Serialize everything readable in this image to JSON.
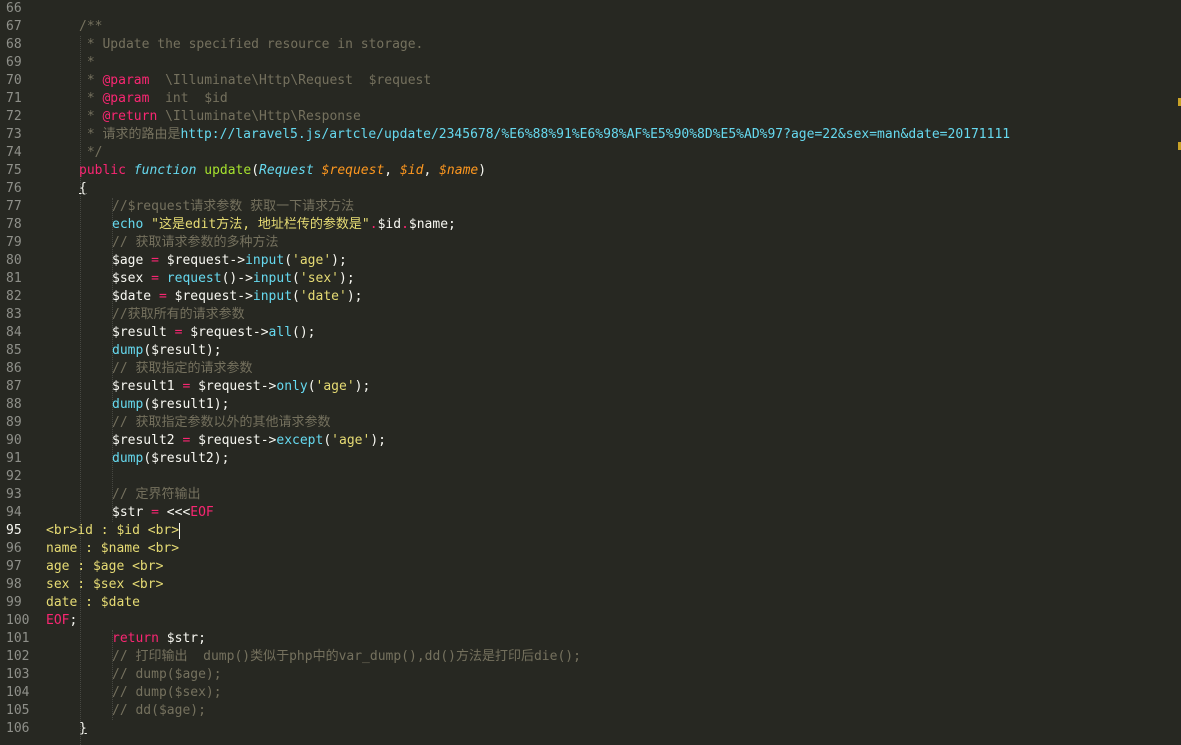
{
  "editor": {
    "language": "php",
    "active_line": "95",
    "theme_colors": {
      "background": "#272822",
      "comment": "#75715E",
      "keyword": "#F92672",
      "function": "#A6E22E",
      "string": "#E6DB74",
      "type": "#66D9EF",
      "parameter": "#FD971F"
    }
  },
  "line_numbers": [
    "66",
    "67",
    "68",
    "69",
    "70",
    "71",
    "72",
    "73",
    "74",
    "75",
    "76",
    "77",
    "78",
    "79",
    "80",
    "81",
    "82",
    "83",
    "84",
    "85",
    "86",
    "87",
    "88",
    "89",
    "90",
    "91",
    "92",
    "93",
    "94",
    "95",
    "96",
    "97",
    "98",
    "99",
    "100",
    "101",
    "102",
    "103",
    "104",
    "105",
    "106"
  ],
  "code": {
    "l67": "/**",
    "l68": " * Update the specified resource in storage.",
    "l69": " *",
    "l70_a": " * ",
    "l70_b": "@param",
    "l70_c": "  \\Illuminate\\Http\\Request  $request",
    "l71_a": " * ",
    "l71_b": "@param",
    "l71_c": "  int  $id",
    "l72_a": " * ",
    "l72_b": "@return",
    "l72_c": " \\Illuminate\\Http\\Response",
    "l73_a": " * 请求的路由是",
    "l73_b": "http://laravel5.js/artcle/update/2345678/%E6%88%91%E6%98%AF%E5%90%8D%E5%AD%97?age=22&sex=man&date=20171111",
    "l74": " */",
    "l75_a": "public",
    "l75_b": "function",
    "l75_c": "update",
    "l75_d": "(",
    "l75_e": "Request",
    "l75_f": "$request",
    "l75_g": ", ",
    "l75_h": "$id",
    "l75_i": ", ",
    "l75_j": "$name",
    "l75_k": ")",
    "l76": "{",
    "l77": "//$request请求参数 获取一下请求方法",
    "l78_a": "echo",
    "l78_b": "\"这是edit方法, 地址栏传的参数是\"",
    "l78_c": ".",
    "l78_d": "$id",
    "l78_e": ".",
    "l78_f": "$name;",
    "l79": "// 获取请求参数的多种方法",
    "l80_a": "$age ",
    "l80_b": "=",
    "l80_c": " $request->",
    "l80_d": "input",
    "l80_e": "(",
    "l80_f": "'age'",
    "l80_g": ");",
    "l81_a": "$sex ",
    "l81_b": "=",
    "l81_c": " ",
    "l81_d": "request",
    "l81_e": "()->",
    "l81_f": "input",
    "l81_g": "(",
    "l81_h": "'sex'",
    "l81_i": ");",
    "l82_a": "$date ",
    "l82_b": "=",
    "l82_c": " $request->",
    "l82_d": "input",
    "l82_e": "(",
    "l82_f": "'date'",
    "l82_g": ");",
    "l83": "//获取所有的请求参数",
    "l84_a": "$result ",
    "l84_b": "=",
    "l84_c": " $request->",
    "l84_d": "all",
    "l84_e": "();",
    "l85_a": "dump",
    "l85_b": "($result);",
    "l86": "// 获取指定的请求参数",
    "l87_a": "$result1 ",
    "l87_b": "=",
    "l87_c": " $request->",
    "l87_d": "only",
    "l87_e": "(",
    "l87_f": "'age'",
    "l87_g": ");",
    "l88_a": "dump",
    "l88_b": "($result1);",
    "l89": "// 获取指定参数以外的其他请求参数",
    "l90_a": "$result2 ",
    "l90_b": "=",
    "l90_c": " $request->",
    "l90_d": "except",
    "l90_e": "(",
    "l90_f": "'age'",
    "l90_g": ");",
    "l91_a": "dump",
    "l91_b": "($result2);",
    "l93": "// 定界符输出",
    "l94_a": "$str ",
    "l94_b": "=",
    "l94_c": " <<<",
    "l94_d": "EOF",
    "l95": "<br>id : $id <br>",
    "l96": "name : $name <br>",
    "l97": "age : $age <br>",
    "l98": "sex : $sex <br>",
    "l99": "date : $date",
    "l100_a": "EOF",
    "l100_b": ";",
    "l101_a": "return",
    "l101_b": " $str;",
    "l102": "// 打印输出  dump()类似于php中的var_dump(),dd()方法是打印后die();",
    "l103": "// dump($age);",
    "l104": "// dump($sex);",
    "l105": "// dd($age);",
    "l106": "}"
  }
}
